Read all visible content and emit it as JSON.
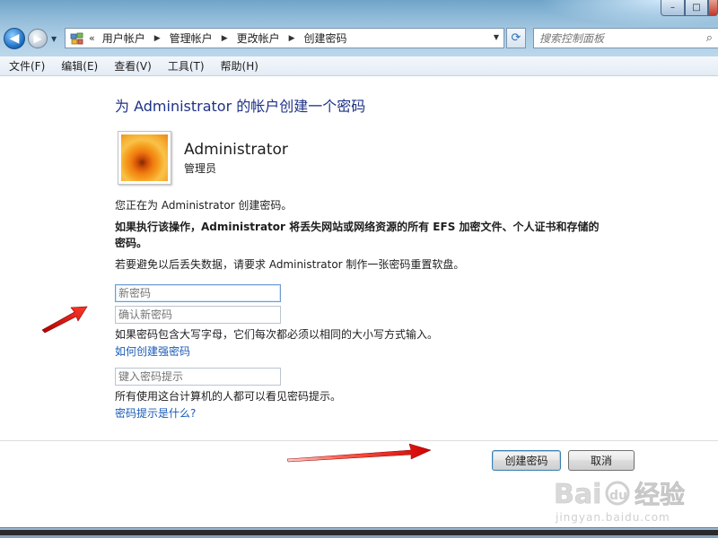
{
  "window": {
    "controls": {
      "minimize": "–",
      "maximize": "□",
      "close": "x"
    }
  },
  "address_bar": {
    "lead": "«",
    "crumbs": [
      "用户帐户",
      "管理帐户",
      "更改帐户",
      "创建密码"
    ],
    "icon": "control-panel-icon"
  },
  "search": {
    "placeholder": "搜索控制面板"
  },
  "menu": {
    "items": [
      "文件(F)",
      "编辑(E)",
      "查看(V)",
      "工具(T)",
      "帮助(H)"
    ]
  },
  "page": {
    "heading": "为 Administrator 的帐户创建一个密码",
    "user": {
      "name": "Administrator",
      "type": "管理员"
    },
    "info_line": "您正在为 Administrator 创建密码。",
    "warning_line1": "如果执行该操作，Administrator 将丢失网站或网络资源的所有 EFS 加密文件、个人证书和存储的",
    "warning_line2": "密码。",
    "reset_line": "若要避免以后丢失数据，请要求 Administrator 制作一张密码重置软盘。",
    "new_password_placeholder": "新密码",
    "confirm_password_placeholder": "确认新密码",
    "case_hint": "如果密码包含大写字母，它们每次都必须以相同的大小写方式输入。",
    "strong_password_link": "如何创建强密码",
    "hint_placeholder": "键入密码提示",
    "hint_notice": "所有使用这台计算机的人都可以看见密码提示。",
    "hint_link": "密码提示是什么?"
  },
  "buttons": {
    "create": "创建密码",
    "cancel": "取消"
  },
  "watermark": {
    "brand": "Baidu经验",
    "url": "jingyan.baidu.com"
  },
  "colors": {
    "heading": "#1e3287",
    "link": "#1a5bb8",
    "arrow": "#e01010"
  }
}
